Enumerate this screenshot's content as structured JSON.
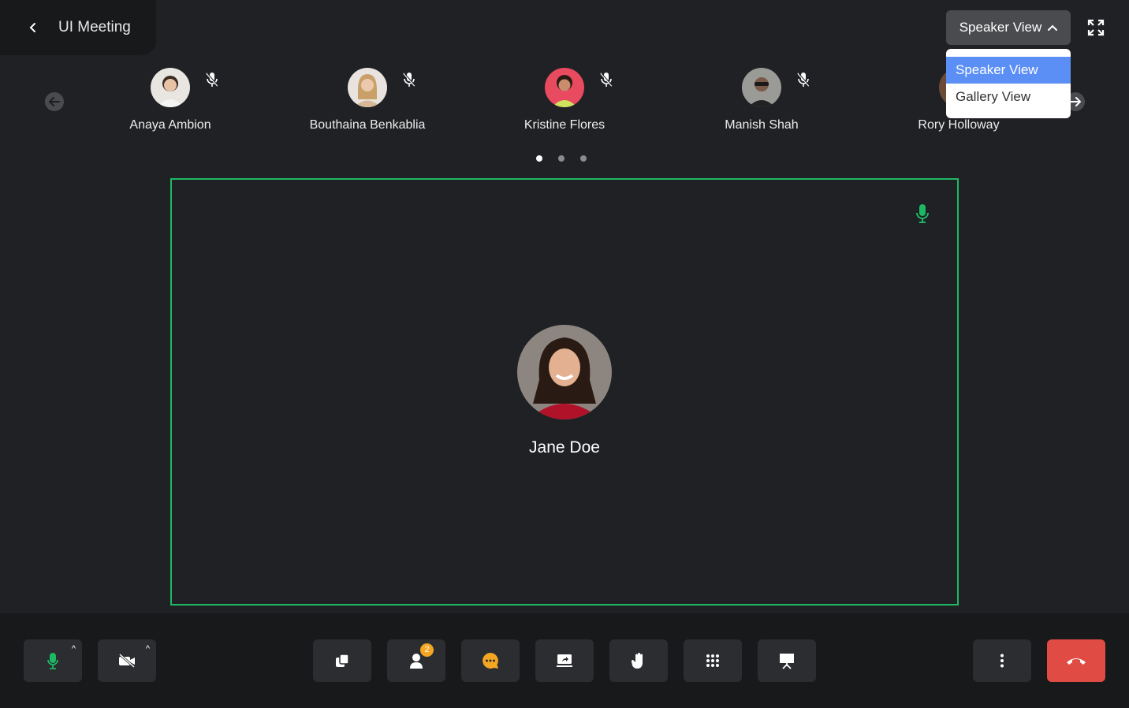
{
  "header": {
    "title": "UI Meeting"
  },
  "view_selector": {
    "label": "Speaker View",
    "options": [
      "Speaker View",
      "Gallery View"
    ],
    "selected": "Speaker View"
  },
  "participants": [
    {
      "name": "Anaya Ambion",
      "muted": true
    },
    {
      "name": "Bouthaina Benkablia",
      "muted": true
    },
    {
      "name": "Kristine Flores",
      "muted": true
    },
    {
      "name": "Manish Shah",
      "muted": true
    },
    {
      "name": "Rory Holloway",
      "muted": true
    }
  ],
  "pagination": {
    "pages": 3,
    "current": 1
  },
  "speaker": {
    "name": "Jane Doe",
    "mic_on": true
  },
  "toolbar": {
    "participants_badge": "2",
    "buttons": [
      "mic",
      "camera",
      "copy",
      "participants",
      "chat",
      "share",
      "raise-hand",
      "apps",
      "present",
      "more",
      "end-call"
    ]
  },
  "colors": {
    "accent_green": "#1db864",
    "highlight_blue": "#5b8ff5",
    "end_red": "#e04b44",
    "badge_orange": "#f5a623"
  }
}
